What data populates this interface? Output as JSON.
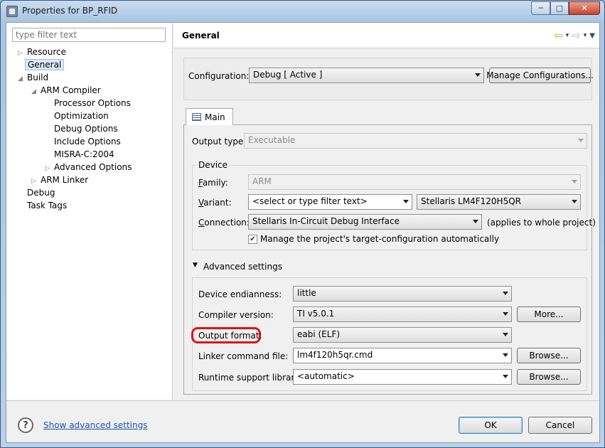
{
  "window": {
    "title": "Properties for BP_RFID",
    "icon": "properties-icon",
    "controls": {
      "minimize": "─",
      "maximize": "□",
      "close": "✕"
    }
  },
  "left": {
    "filter_placeholder": "type filter text",
    "tree": [
      {
        "label": "Resource",
        "expander": "▷"
      },
      {
        "label": "General",
        "selected": true
      },
      {
        "label": "Build",
        "expander": "◢"
      },
      {
        "label": "ARM Compiler",
        "expander": "◢"
      },
      {
        "label": "Processor Options"
      },
      {
        "label": "Optimization"
      },
      {
        "label": "Debug Options"
      },
      {
        "label": "Include Options"
      },
      {
        "label": "MISRA-C:2004"
      },
      {
        "label": "Advanced Options",
        "expander": "▷"
      },
      {
        "label": "ARM Linker",
        "expander": "▷"
      },
      {
        "label": "Debug"
      },
      {
        "label": "Task Tags"
      }
    ]
  },
  "right": {
    "header": {
      "title": "General",
      "back": "⇦",
      "forward": "⇨",
      "dropdown": "▾",
      "menu": "▼"
    },
    "configuration": {
      "label": "Configuration:",
      "value": "Debug  [ Active ]",
      "manage_button": "Manage Configurations..."
    },
    "tab": {
      "label": "Main"
    },
    "output_type": {
      "label": "Output type:",
      "value": "Executable"
    },
    "device": {
      "group_label": "Device",
      "family_label": "Family:",
      "family_value": "ARM",
      "variant_label": "Variant:",
      "variant_filter": "<select or type filter text>",
      "variant_value": "Stellaris LM4F120H5QR",
      "connection_label": "Connection:",
      "connection_value": "Stellaris In-Circuit Debug Interface",
      "connection_note": "(applies to whole project)",
      "manage_checkbox": "Manage the project's target-configuration automatically",
      "manage_checked": true
    },
    "advanced": {
      "toggle_label": "Advanced settings",
      "endianness_label": "Device endianness:",
      "endianness_value": "little",
      "compiler_label": "Compiler version:",
      "compiler_value": "TI v5.0.1",
      "more_button": "More...",
      "output_format_label": "Output format:",
      "output_format_value": "eabi (ELF)",
      "linker_label": "Linker command file:",
      "linker_value": "lm4f120h5qr.cmd",
      "browse1": "Browse...",
      "runtime_label": "Runtime support library:",
      "runtime_value": "<automatic>",
      "browse2": "Browse..."
    }
  },
  "footer": {
    "help": "?",
    "link": "Show advanced settings",
    "ok": "OK",
    "cancel": "Cancel"
  },
  "colors": {
    "highlight": "#e0121a",
    "link": "#1a56b5",
    "selection": "#dceaf9"
  }
}
